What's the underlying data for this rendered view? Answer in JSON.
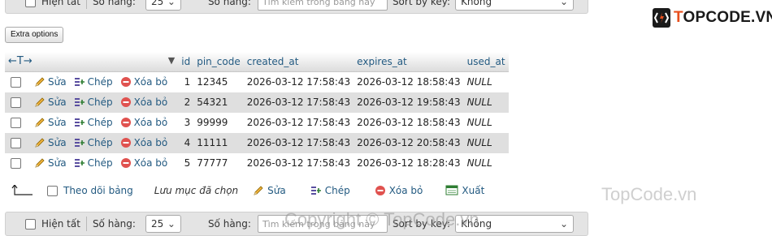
{
  "nav": {
    "show_all": "Hiện tất",
    "rows_label": "Số hàng:",
    "rows_value": "25",
    "filter_label": "Số hàng:",
    "filter_placeholder": "Tìm kiếm trong bảng này",
    "sort_label": "Sort by key:",
    "sort_value": "Không"
  },
  "extra_options": "Extra options",
  "table": {
    "columns": [
      "id",
      "pin_code",
      "created_at",
      "expires_at",
      "used_at"
    ],
    "actions": {
      "edit": "Sửa",
      "copy": "Chép",
      "delete": "Xóa bỏ"
    },
    "rows": [
      {
        "id": "1",
        "pin_code": "12345",
        "created_at": "2026-03-12 17:58:43",
        "expires_at": "2026-03-12 18:58:43",
        "used_at": "NULL"
      },
      {
        "id": "2",
        "pin_code": "54321",
        "created_at": "2026-03-12 17:58:43",
        "expires_at": "2026-03-12 19:58:43",
        "used_at": "NULL"
      },
      {
        "id": "3",
        "pin_code": "99999",
        "created_at": "2026-03-12 17:58:43",
        "expires_at": "2026-03-12 18:58:43",
        "used_at": "NULL"
      },
      {
        "id": "4",
        "pin_code": "11111",
        "created_at": "2026-03-12 17:58:43",
        "expires_at": "2026-03-12 20:58:43",
        "used_at": "NULL"
      },
      {
        "id": "5",
        "pin_code": "77777",
        "created_at": "2026-03-12 17:58:43",
        "expires_at": "2026-03-12 18:28:43",
        "used_at": "NULL"
      }
    ]
  },
  "bulk": {
    "check_all": "Theo dõi bảng",
    "with_selected": "Lưu mục đã chọn",
    "edit": "Sửa",
    "copy": "Chép",
    "delete": "Xóa bỏ",
    "export": "Xuất"
  },
  "watermarks": {
    "logo_t": "T",
    "logo_rest": "OPCODE.VN",
    "right": "TopCode.vn",
    "copyright": "Copyright © TopCode.vn"
  },
  "colors": {
    "link": "#235a81",
    "row_alt": "#dfdfdf",
    "toolbar": "#e4e4e4",
    "brand_orange": "#e8501e"
  }
}
